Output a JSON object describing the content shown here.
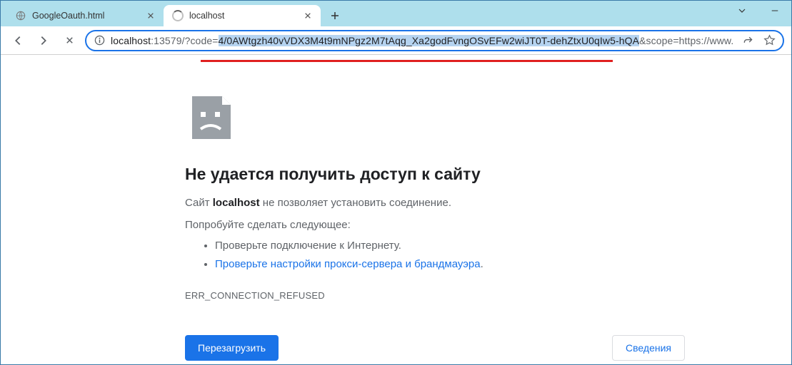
{
  "window": {
    "tabs": [
      {
        "title": "GoogleOauth.html",
        "active": false
      },
      {
        "title": "localhost",
        "active": true
      }
    ]
  },
  "toolbar": {
    "url": {
      "prefix": "localhost",
      "port_and_path": ":13579/?code=",
      "highlighted": "4/0AWtgzh40vVDX3M4t9mNPgz2M7tAqg_Xa2godFvngOSvEFw2wiJT0T-dehZtxU0qIw5-hQA",
      "suffix": "&scope=https://www.googl"
    }
  },
  "page": {
    "headline": "Не удается получить доступ к сайту",
    "desc_prefix": "Сайт ",
    "desc_bold": "localhost",
    "desc_suffix": " не позволяет установить соединение.",
    "try_label": "Попробуйте сделать следующее:",
    "suggestions": {
      "check_connection": "Проверьте подключение к Интернету.",
      "check_proxy_link": "Проверьте настройки прокси-сервера и брандмауэра"
    },
    "error_code": "ERR_CONNECTION_REFUSED",
    "reload_button": "Перезагрузить",
    "details_button": "Сведения"
  }
}
